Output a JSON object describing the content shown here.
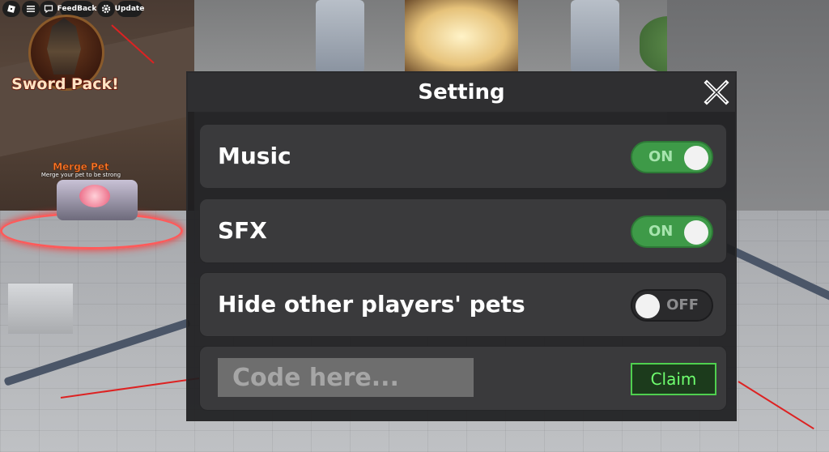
{
  "topbar": {
    "feedback_label": "FeedBack",
    "update_label": "Update"
  },
  "promo": {
    "sword_pack_label": "Sword Pack!",
    "merge_pet_title": "Merge Pet",
    "merge_pet_subtitle": "Merge your pet to be strong"
  },
  "dialog": {
    "title": "Setting",
    "settings": [
      {
        "label": "Music",
        "state": "ON"
      },
      {
        "label": "SFX",
        "state": "ON"
      },
      {
        "label": "Hide other players' pets",
        "state": "OFF"
      }
    ],
    "code": {
      "placeholder": "Code here...",
      "claim_label": "Claim"
    }
  },
  "colors": {
    "toggle_on": "#3e9a48",
    "toggle_off": "#2a2a2c",
    "claim_border": "#4fcf4f"
  }
}
